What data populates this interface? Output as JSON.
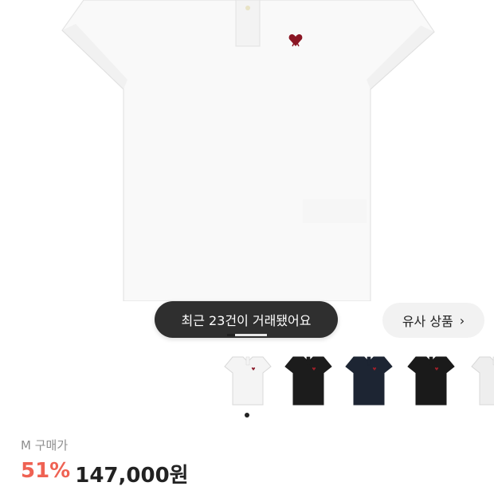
{
  "colors": {
    "accent_red": "#ef6253",
    "toast_bg": "#2f2f2f",
    "chip_bg": "#f2f2f2"
  },
  "gallery": {
    "toast_text": "최근 23건이 거래됐어요",
    "similar_button_label": "유사 상품",
    "progress_fraction": 0.2
  },
  "thumbnails": [
    {
      "color": "#f4f4f4",
      "logo": "#8a1a2a",
      "name": "white"
    },
    {
      "color": "#1c1c1c",
      "logo": "#a0202a",
      "name": "black"
    },
    {
      "color": "#1d2533",
      "logo": "#a0202a",
      "name": "navy"
    },
    {
      "color": "#1a1a1a",
      "logo": "#a0202a",
      "name": "black-2"
    },
    {
      "color": "#eeeeee",
      "logo": "#8a1a2a",
      "name": "white-2"
    }
  ],
  "product": {
    "size": "M",
    "price_label": "구매가",
    "discount": "51%",
    "price": "147,000원"
  }
}
